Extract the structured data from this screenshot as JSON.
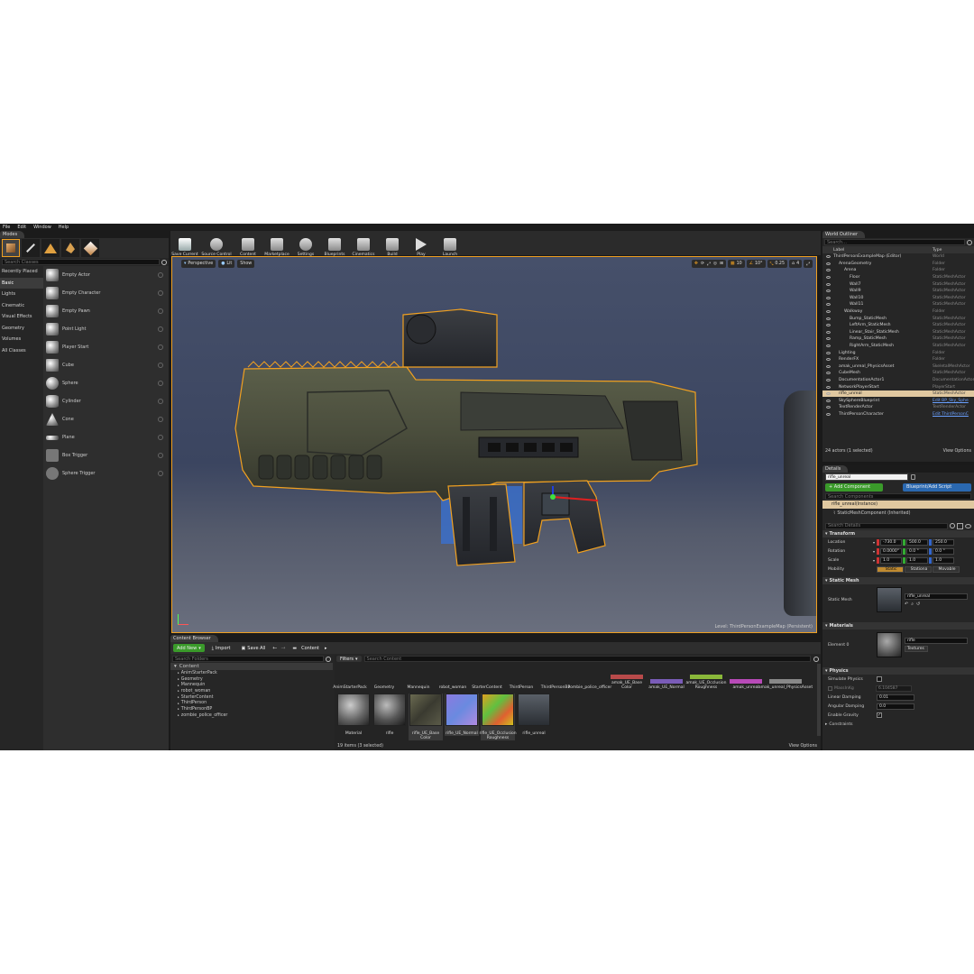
{
  "menu": [
    "File",
    "Edit",
    "Window",
    "Help"
  ],
  "modes": {
    "tab": "Modes",
    "search_placeholder": "Search Classes",
    "categories": [
      "Recently Placed",
      "Basic",
      "Lights",
      "Cinematic",
      "Visual Effects",
      "Geometry",
      "Volumes",
      "All Classes"
    ],
    "items": [
      "Empty Actor",
      "Empty Character",
      "Empty Pawn",
      "Point Light",
      "Player Start",
      "Cube",
      "Sphere",
      "Cylinder",
      "Cone",
      "Plane",
      "Box Trigger",
      "Sphere Trigger"
    ]
  },
  "toolbar": {
    "buttons": [
      "Save Current",
      "Source Control",
      "Content",
      "Marketplace",
      "Settings",
      "Blueprints",
      "Cinematics",
      "Build",
      "Play",
      "Launch"
    ]
  },
  "viewport": {
    "perspective": "Perspective",
    "lit": "Lit",
    "show": "Show",
    "grid": "10",
    "angle": "10°",
    "scale": "0.25",
    "cam": "4",
    "level": "Level: ThirdPersonExampleMap (Persistent)"
  },
  "outliner": {
    "tab": "World Outliner",
    "search_placeholder": "Search...",
    "col_label": "Label",
    "col_type": "Type",
    "rows": [
      {
        "label": "ThirdPersonExampleMap (Editor)",
        "type": "World",
        "indent": 0
      },
      {
        "label": "ArenaGeometry",
        "type": "Folder",
        "indent": 1
      },
      {
        "label": "Arena",
        "type": "Folder",
        "indent": 2
      },
      {
        "label": "Floor",
        "type": "StaticMeshActor",
        "indent": 3
      },
      {
        "label": "Wall7",
        "type": "StaticMeshActor",
        "indent": 3
      },
      {
        "label": "Wall9",
        "type": "StaticMeshActor",
        "indent": 3
      },
      {
        "label": "Wall10",
        "type": "StaticMeshActor",
        "indent": 3
      },
      {
        "label": "Wall11",
        "type": "StaticMeshActor",
        "indent": 3
      },
      {
        "label": "Walkway",
        "type": "Folder",
        "indent": 2
      },
      {
        "label": "Bump_StaticMesh",
        "type": "StaticMeshActor",
        "indent": 3
      },
      {
        "label": "LeftArm_StaticMesh",
        "type": "StaticMeshActor",
        "indent": 3
      },
      {
        "label": "Linear_Stair_StaticMesh",
        "type": "StaticMeshActor",
        "indent": 3
      },
      {
        "label": "Ramp_StaticMesh",
        "type": "StaticMeshActor",
        "indent": 3
      },
      {
        "label": "RightArm_StaticMesh",
        "type": "StaticMeshActor",
        "indent": 3
      },
      {
        "label": "Lighting",
        "type": "Folder",
        "indent": 1
      },
      {
        "label": "RenderFX",
        "type": "Folder",
        "indent": 1
      },
      {
        "label": "amak_unreal_PhysicsAsset",
        "type": "SkeletalMeshActor",
        "indent": 1
      },
      {
        "label": "CubeMesh",
        "type": "StaticMeshActor",
        "indent": 1
      },
      {
        "label": "DocumentationActor1",
        "type": "DocumentationActor",
        "indent": 1
      },
      {
        "label": "NetworkPlayerStart",
        "type": "PlayerStart",
        "indent": 1
      },
      {
        "label": "rifle_unreal",
        "type": "StaticMeshActor",
        "indent": 1,
        "selected": true
      },
      {
        "label": "SkySphereBlueprint",
        "type": "Edit BP_Sky_Sphe",
        "indent": 1,
        "link": true
      },
      {
        "label": "TextRenderActor",
        "type": "TextRenderActor",
        "indent": 1
      },
      {
        "label": "ThirdPersonCharacter",
        "type": "Edit ThirdPersonC",
        "indent": 1,
        "link": true
      }
    ],
    "status": "24 actors (1 selected)",
    "view_options": "View Options"
  },
  "details": {
    "tab": "Details",
    "name_value": "rifle_unreal",
    "add_component": "+ Add Component",
    "blueprint_script": "Blueprint/Add Script",
    "search_components": "Search Components",
    "instance": "rifle_unreal(Instance)",
    "component": "StaticMeshComponent (Inherited)",
    "search_details": "Search Details",
    "transform": "Transform",
    "location": {
      "label": "Location",
      "x": "-730.0",
      "y": "500.0",
      "z": "250.0"
    },
    "rotation": {
      "label": "Rotation",
      "x": "0.0000°",
      "y": "0.0 °",
      "z": "0.0 °"
    },
    "scale": {
      "label": "Scale",
      "x": "1.0",
      "y": "1.0",
      "z": "1.0"
    },
    "mobility": {
      "label": "Mobility",
      "options": [
        "Static",
        "Stationa",
        "Movable"
      ]
    },
    "static_mesh_hdr": "Static Mesh",
    "static_mesh_label": "Static Mesh",
    "static_mesh_value": "rifle_unreal",
    "materials_hdr": "Materials",
    "element0": "Element 0",
    "element0_value": "rifle",
    "textures": "Textures",
    "physics_hdr": "Physics",
    "simulate_physics": "Simulate Physics",
    "mass_kg": "MassInKg",
    "mass_value": "6.104587",
    "linear_damping": "Linear Damping",
    "linear_damping_value": "0.01",
    "angular_damping": "Angular Damping",
    "angular_damping_value": "0.0",
    "enable_gravity": "Enable Gravity",
    "constraints": "Constraints"
  },
  "content": {
    "tab": "Content Browser",
    "add_new": "Add New",
    "import": "Import",
    "save_all": "Save All",
    "path": "Content",
    "search_folders": "Search Folders",
    "filters": "Filters",
    "search_content": "Search Content",
    "tree_root": "Content",
    "tree": [
      "AnimStarterPack",
      "Geometry",
      "Mannequin",
      "robot_woman",
      "StarterContent",
      "ThirdPerson",
      "ThirdPersonBP",
      "zombie_police_officer"
    ],
    "folders": [
      "AnimStarterPack",
      "Geometry",
      "Mannequin",
      "robot_woman",
      "StarterContent",
      "ThirdPerson",
      "ThirdPersonBP",
      "zombie_police_officer"
    ],
    "top_assets": [
      "amak_UE_Base Color",
      "amak_UE_Normal",
      "amak_UE_Occlusion Roughness",
      "amak_unreal",
      "amak_unreal_PhysicsAsset"
    ],
    "assets": [
      "Material",
      "rifle",
      "rifle_UE_Base Color",
      "rifle_UE_Normal",
      "rifle_UE_Occlusion Roughness",
      "rifle_unreal"
    ],
    "status": "19 items (3 selected)",
    "view_options": "View Options"
  },
  "colors": {
    "accent": "#f0a020",
    "add_green": "#3a9a2a",
    "blueprint_blue": "#2a68b0",
    "selection": "#e0c8a0"
  }
}
